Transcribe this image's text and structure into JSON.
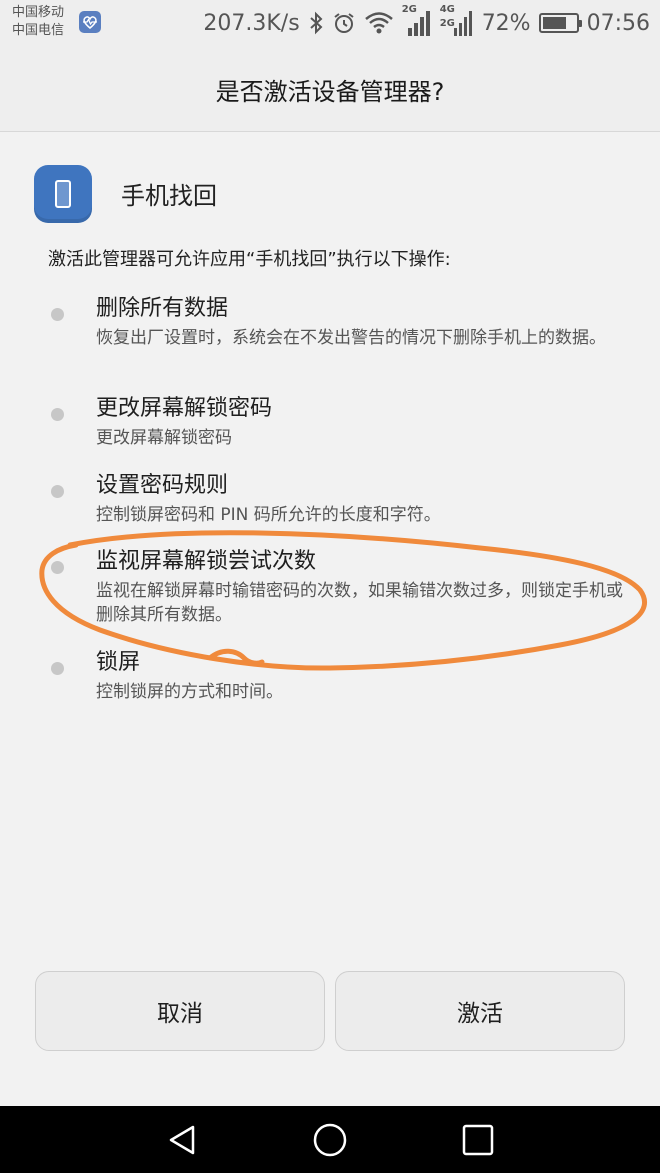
{
  "status_bar": {
    "carrier_1": "中国移动",
    "carrier_2": "中国电信",
    "network_speed": "207.3K/s",
    "network_badge_1": "2G",
    "network_badge_2a": "4G",
    "network_badge_2b": "2G",
    "battery": "72%",
    "battery_level_percent": 72,
    "time": "07:56",
    "icons": [
      "health-app-icon",
      "bluetooth-icon",
      "alarm-icon",
      "wifi-icon",
      "signal-icon",
      "signal-icon",
      "battery-icon"
    ]
  },
  "dialog": {
    "title": "是否激活设备管理器?",
    "app_name": "手机找回",
    "app_icon": "phone-icon",
    "intro": "激活此管理器可允许应用“手机找回”执行以下操作:"
  },
  "permissions": [
    {
      "title": "删除所有数据",
      "description": "恢复出厂设置时，系统会在不发出警告的情况下删除手机上的数据。"
    },
    {
      "title": "更改屏幕解锁密码",
      "description": "更改屏幕解锁密码"
    },
    {
      "title": "设置密码规则",
      "description": "控制锁屏密码和 PIN 码所允许的长度和字符。"
    },
    {
      "title": "监视屏幕解锁尝试次数",
      "description": "监视在解锁屏幕时输错密码的次数，如果输错次数过多，则锁定手机或删除其所有数据。"
    },
    {
      "title": "锁屏",
      "description": "控制锁屏的方式和时间。"
    }
  ],
  "buttons": {
    "cancel": "取消",
    "activate": "激活"
  },
  "colors": {
    "highlight": "#f08a3c",
    "app_icon_bg": "#3f75bf"
  },
  "nav_bar": {
    "icons": [
      "back-icon",
      "home-icon",
      "recents-icon"
    ]
  }
}
